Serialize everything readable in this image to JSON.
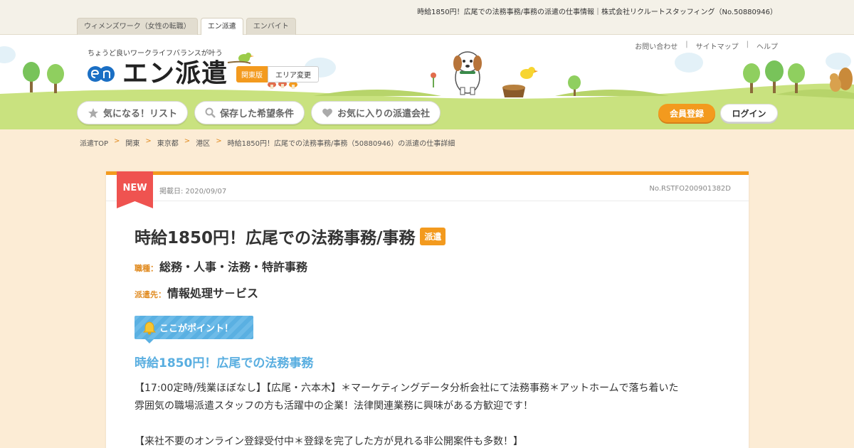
{
  "page_title": "時給1850円！広尾での法務事務/事務の派遣の仕事情報｜株式会社リクルートスタッフィング（No.50880946）",
  "site_tabs": [
    {
      "label": "ウィメンズワーク（女性の転職）"
    },
    {
      "label": "エン派遣"
    },
    {
      "label": "エンバイト"
    }
  ],
  "header": {
    "tagline": "ちょうど良いワークライフバランスが叶う",
    "logo_text": "エン派遣",
    "region": "関東版",
    "region_change": "エリア変更",
    "util_links": [
      "お問い合わせ",
      "サイトマップ",
      "ヘルプ"
    ]
  },
  "nav": {
    "watchlist": "気になる！リスト",
    "saved_conditions": "保存した希望条件",
    "favorite_companies": "お気に入りの派遣会社",
    "register": "会員登録",
    "login": "ログイン"
  },
  "breadcrumb": [
    "派遣TOP",
    "関東",
    "東京都",
    "港区",
    "時給1850円！広尾での法務事務/事務（50880946）の派遣の仕事詳細"
  ],
  "job": {
    "new_badge": "NEW",
    "posted": "掲載日: 2020/09/07",
    "number": "No.RSTFO200901382D",
    "title": "時給1850円！広尾での法務事務/事務",
    "type_tag": "派遣",
    "category_label": "職種：",
    "category": "総務・人事・法務・特許事務",
    "client_label": "派遣先：",
    "client": "情報処理サ－ビス",
    "point_label": "ここがポイント！",
    "catch": "時給1850円！広尾での法務事務",
    "description": [
      "【17:00定時/残業ほぼなし】【広尾・六本木】＊マーケティングデータ分析会社にて法務事務＊アットホームで落ち着いた",
      "雰囲気の職場派遣スタッフの方も活躍中の企業！法律関連業務に興味がある方歓迎です！",
      "【来社不要のオンライン登録受付中＊登録を完了した方が見れる非公開案件も多数！】"
    ]
  },
  "colors": {
    "accent": "#f39a1e",
    "background": "#fcecd5",
    "point_blue": "#59aee0",
    "grass": "#c5df7a"
  }
}
